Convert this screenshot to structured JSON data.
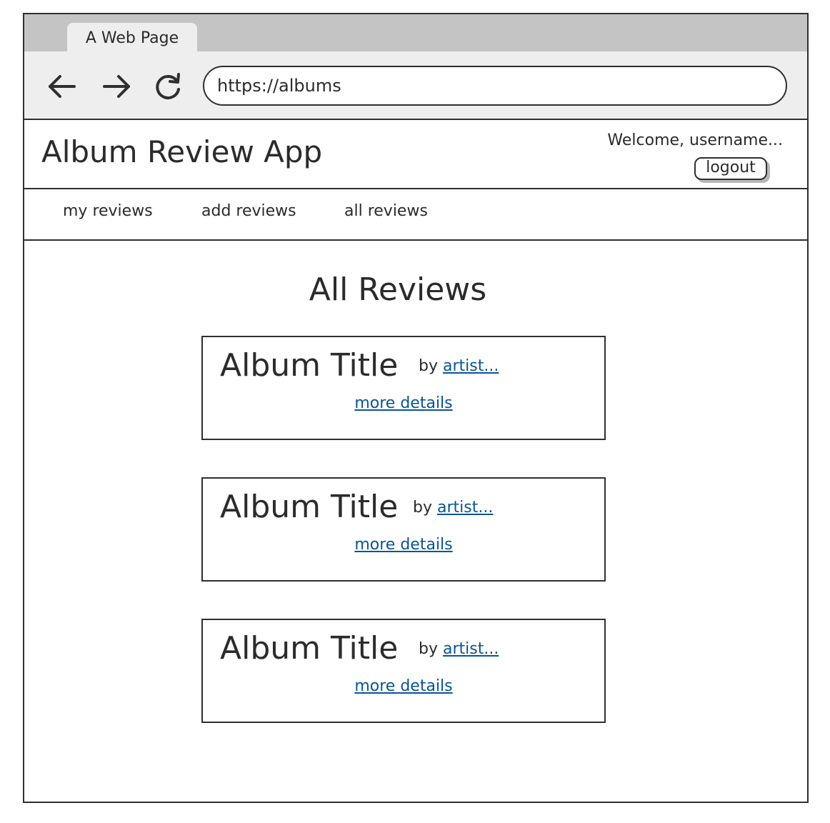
{
  "browser": {
    "tab_title": "A Web Page",
    "url": "https://albums"
  },
  "header": {
    "app_title": "Album Review App",
    "welcome_text": "Welcome, username...",
    "logout_label": "logout"
  },
  "nav": {
    "items": [
      {
        "label": "my reviews"
      },
      {
        "label": "add reviews"
      },
      {
        "label": "all reviews"
      }
    ]
  },
  "main": {
    "heading": "All Reviews",
    "cards": [
      {
        "title": "Album Title",
        "by_label": "by",
        "artist": "artist...",
        "details_link": "more details"
      },
      {
        "title": "Album Title",
        "by_label": "by",
        "artist": "artist...",
        "details_link": "more details"
      },
      {
        "title": "Album Title",
        "by_label": "by",
        "artist": "artist...",
        "details_link": "more details"
      }
    ]
  },
  "icons": {
    "back": "arrow-left-icon",
    "forward": "arrow-right-icon",
    "reload": "reload-icon"
  },
  "colors": {
    "link": "#0a5494",
    "tabstrip": "#c4c4c4",
    "toolbar": "#eeeeee",
    "ink": "#2f2f2f"
  }
}
